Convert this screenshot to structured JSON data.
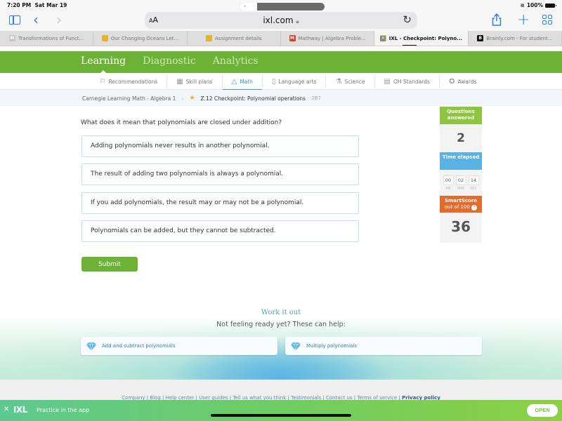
{
  "status_bar": {
    "time": "7:20 PM",
    "date": "Sat Mar 19",
    "battery": "100%"
  },
  "browser": {
    "text_size_label": "AA",
    "url": "ixl.com",
    "tabs": [
      {
        "title": "Transformations of Funct...",
        "favicon": "M",
        "favicon_color": "#c8c8c8",
        "active": false
      },
      {
        "title": "Our Changing Oceans Let...",
        "favicon": "classroom",
        "favicon_color": "#e0b72a",
        "active": false
      },
      {
        "title": "Assignment details",
        "favicon": "classroom",
        "favicon_color": "#e0b72a",
        "active": false
      },
      {
        "title": "Mathway | Algebra Proble...",
        "favicon": "M",
        "favicon_color": "#d4402c",
        "active": false
      },
      {
        "title": "IXL - Checkpoint: Polyno...",
        "favicon": "IXL",
        "favicon_color": "#c6d94a",
        "active": true
      },
      {
        "title": "Brainly.com - For student...",
        "favicon": "B",
        "favicon_color": "#111111",
        "active": false
      }
    ]
  },
  "ixl": {
    "main_nav": [
      "Learning",
      "Diagnostic",
      "Analytics"
    ],
    "main_nav_active": "Learning",
    "sub_nav": [
      {
        "label": "Recommendations",
        "icon": "recommendations-icon",
        "glyph": "⚐",
        "active": false
      },
      {
        "label": "Skill plans",
        "icon": "skill-plans-icon",
        "glyph": "▦",
        "active": false
      },
      {
        "label": "Math",
        "icon": "math-pyramid-icon",
        "glyph": "△",
        "active": true
      },
      {
        "label": "Language arts",
        "icon": "book-icon",
        "glyph": "▯",
        "active": false
      },
      {
        "label": "Science",
        "icon": "flask-icon",
        "glyph": "⚗",
        "active": false
      },
      {
        "label": "OH Standards",
        "icon": "clipboard-icon",
        "glyph": "▤",
        "active": false
      },
      {
        "label": "Awards",
        "icon": "awards-icon",
        "glyph": "✪",
        "active": false
      }
    ],
    "breadcrumb": {
      "course": "Carnegie Learning Math - Algebra 1",
      "skill": "Z.12 Checkpoint: Polynomial operations",
      "code": "2B7"
    }
  },
  "question": {
    "prompt": "What does it mean that polynomials are closed under addition?",
    "choices": [
      "Adding polynomials never results in another polynomial.",
      "The result of adding two polynomials is always a polynomial.",
      "If you add polynomials, the result may or may not be a polynomial.",
      "Polynomials can be added, but they cannot be subtracted."
    ],
    "submit_label": "Submit"
  },
  "stats": {
    "questions_answered_label": "Questions answered",
    "questions_answered": "2",
    "time_elapsed_label": "Time elapsed",
    "time": {
      "hr": "00",
      "min": "02",
      "sec": "14"
    },
    "time_units": {
      "hr": "HR",
      "min": "MIN",
      "sec": "SEC"
    },
    "smartscore_label": "SmartScore",
    "smartscore_sub": "out of 100",
    "smartscore": "36",
    "colors": {
      "questions": "#8fc441",
      "time": "#5bb1e1",
      "smartscore": "#e26b2e"
    }
  },
  "work_it_out": {
    "title": "Work it out",
    "subtitle": "Not feeling ready yet? These can help:",
    "links": [
      "Add and subtract polynomials",
      "Multiply polynomials"
    ]
  },
  "footer": {
    "links": [
      "Company",
      "Blog",
      "Help center",
      "User guides",
      "Tell us what you think",
      "Testimonials",
      "Contact us",
      "Terms of service"
    ],
    "bold_link": "Privacy policy"
  },
  "app_banner": {
    "logo": "IXL",
    "text": "Practice in the app",
    "open_label": "OPEN"
  }
}
